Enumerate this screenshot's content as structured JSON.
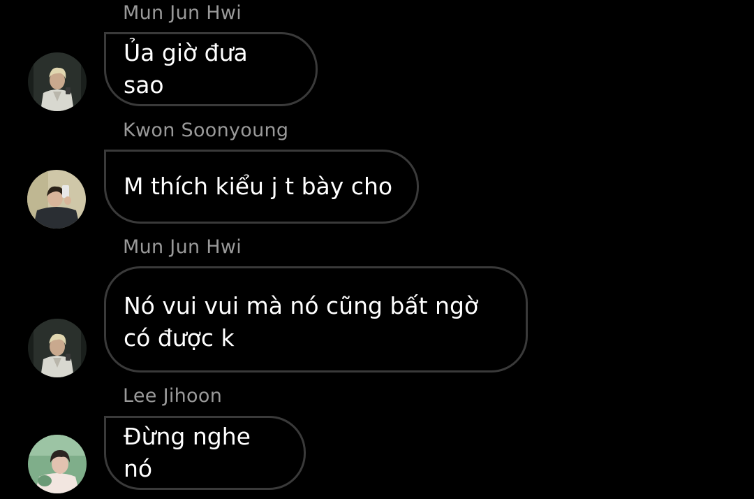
{
  "messages": [
    {
      "sender": "Mun Jun Hwi",
      "text": "Ủa giờ đưa sao",
      "avatar_icon": "user-photo-icon",
      "avatar_colors": {
        "bg": "#1e2420",
        "shirt": "#d8d8d0",
        "hair": "#e0d6b0",
        "skin": "#c9a98e"
      }
    },
    {
      "sender": "Kwon Soonyoung",
      "text": "M thích kiểu j t bày cho",
      "avatar_icon": "user-photo-icon",
      "avatar_colors": {
        "bg": "#cfc7a8",
        "shirt": "#2a2e33",
        "hair": "#2a2118",
        "skin": "#d8b59a"
      }
    },
    {
      "sender": "Mun Jun Hwi",
      "text": "Nó vui vui mà nó cũng bất ngờ\ncó được k",
      "avatar_icon": "user-photo-icon",
      "avatar_colors": {
        "bg": "#1e2420",
        "shirt": "#d8d8d0",
        "hair": "#e0d6b0",
        "skin": "#c9a98e"
      }
    },
    {
      "sender": "Lee Jihoon",
      "text": "Đừng nghe nó",
      "avatar_icon": "user-photo-icon",
      "avatar_colors": {
        "bg": "#7fae8a",
        "shirt": "#f2e6e0",
        "hair": "#2b2420",
        "skin": "#e2c2b0"
      }
    }
  ]
}
